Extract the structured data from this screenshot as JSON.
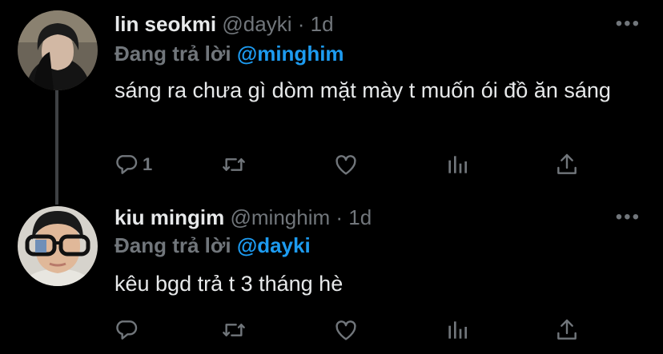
{
  "tweets": [
    {
      "name": "lin seokmi",
      "handle": "@dayki",
      "separator": "·",
      "time": "1d",
      "replying_label": "Đang trả lời",
      "replying_to": "@minghim",
      "text": "sáng ra chưa gì dòm mặt mày t muốn ói đồ ăn sáng",
      "reply_count": "1"
    },
    {
      "name": "kiu mingim",
      "handle": "@minghim",
      "separator": "·",
      "time": "1d",
      "replying_label": "Đang trả lời",
      "replying_to": "@dayki",
      "text": "kêu bgd trả t 3 tháng hè",
      "reply_count": ""
    }
  ],
  "icons": {
    "reply": "reply-icon",
    "retweet": "retweet-icon",
    "like": "like-icon",
    "analytics": "analytics-icon",
    "share": "share-icon",
    "more": "more-icon"
  },
  "colors": {
    "background": "#000000",
    "text": "#e7e9ea",
    "muted": "#71767b",
    "mention": "#1d9bf0",
    "thread_line": "#3e4144"
  }
}
